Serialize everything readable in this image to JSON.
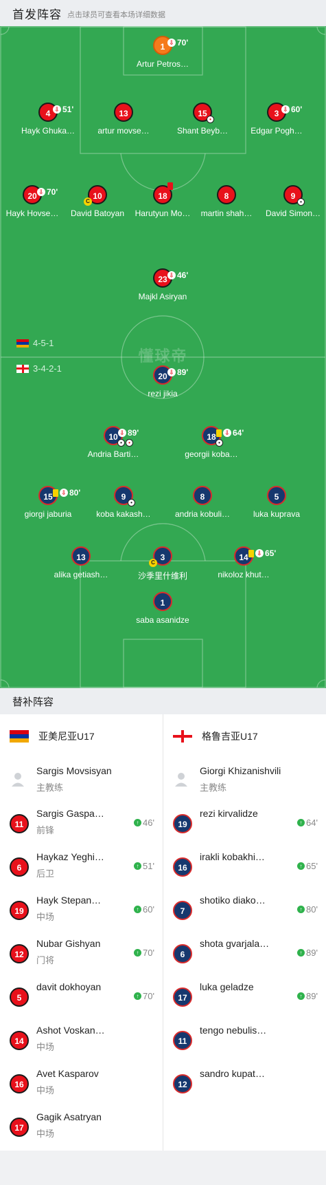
{
  "header": {
    "title": "首发阵容",
    "subtitle": "点击球员可查看本场详细数据"
  },
  "pitch": {
    "watermark": "懂球帝",
    "formations": [
      {
        "team": "armenia",
        "value": "4-5-1"
      },
      {
        "team": "georgia",
        "value": "3-4-2-1"
      }
    ],
    "home_players": [
      {
        "num": "1",
        "name": "Artur Petros…",
        "kit": "gk",
        "events": {
          "sub": true,
          "minute": "70'"
        }
      },
      {
        "num": "4",
        "name": "Hayk Ghuka…",
        "kit": "red",
        "events": {
          "sub": true,
          "minute": "51'"
        }
      },
      {
        "num": "13",
        "name": "artur movse…",
        "kit": "red"
      },
      {
        "num": "15",
        "name": "Shant Beyb…",
        "kit": "red",
        "ball": "og"
      },
      {
        "num": "3",
        "name": "Edgar Pogh…",
        "kit": "red",
        "events": {
          "sub": true,
          "minute": "60'"
        }
      },
      {
        "num": "20",
        "name": "Hayk Hovse…",
        "kit": "red",
        "events": {
          "sub": true,
          "minute": "70'"
        }
      },
      {
        "num": "10",
        "name": "David Batoyan",
        "kit": "red",
        "captain": "C"
      },
      {
        "num": "18",
        "name": "Harutyun Mo…",
        "kit": "red",
        "events": {
          "red_card": true
        }
      },
      {
        "num": "8",
        "name": "martin shah…",
        "kit": "red"
      },
      {
        "num": "9",
        "name": "David Simon…",
        "kit": "red",
        "ball": "goal"
      },
      {
        "num": "23",
        "name": "Majkl Asiryan",
        "kit": "red",
        "events": {
          "sub": true,
          "minute": "46'"
        }
      }
    ],
    "away_players": [
      {
        "num": "20",
        "name": "rezi jikia",
        "kit": "blue",
        "events": {
          "sub": true,
          "minute": "89'"
        }
      },
      {
        "num": "10",
        "name": "Andria Barti…",
        "kit": "blue",
        "events": {
          "sub": true,
          "minute": "89'"
        },
        "ball": "goal2"
      },
      {
        "num": "18",
        "name": "georgii koba…",
        "kit": "blue",
        "events": {
          "yellow": true,
          "sub": true,
          "minute": "64'"
        },
        "ball": "goal"
      },
      {
        "num": "15",
        "name": "giorgi jaburia",
        "kit": "blue",
        "events": {
          "yellow": true,
          "sub": true,
          "minute": "80'"
        }
      },
      {
        "num": "9",
        "name": "koba kakash…",
        "kit": "blue",
        "ball": "goal"
      },
      {
        "num": "8",
        "name": "andria kobuli…",
        "kit": "blue"
      },
      {
        "num": "5",
        "name": "luka kuprava",
        "kit": "blue"
      },
      {
        "num": "13",
        "name": "alika getiash…",
        "kit": "blue"
      },
      {
        "num": "3",
        "name": "沙季里什维利",
        "kit": "blue",
        "captain": "C"
      },
      {
        "num": "14",
        "name": "nikoloz khut…",
        "kit": "blue",
        "events": {
          "yellow": true,
          "sub": true,
          "minute": "65'"
        }
      },
      {
        "num": "1",
        "name": "saba asanidze",
        "kit": "blue"
      }
    ]
  },
  "subs": {
    "title": "替补阵容",
    "home": {
      "team": "亚美尼亚U17",
      "coach": {
        "name": "Sargis Movsisyan",
        "role": "主教练"
      },
      "players": [
        {
          "num": "11",
          "name": "Sargis Gaspa…",
          "pos": "前锋",
          "in": "46'"
        },
        {
          "num": "6",
          "name": "Haykaz Yeghi…",
          "pos": "后卫",
          "in": "51'"
        },
        {
          "num": "19",
          "name": "Hayk Stepan…",
          "pos": "中场",
          "in": "60'"
        },
        {
          "num": "12",
          "name": "Nubar Gishyan",
          "pos": "门将",
          "in": "70'"
        },
        {
          "num": "5",
          "name": "davit dokhoyan",
          "pos": "",
          "in": "70'"
        },
        {
          "num": "14",
          "name": "Ashot Voskan…",
          "pos": "中场",
          "in": ""
        },
        {
          "num": "16",
          "name": "Avet Kasparov",
          "pos": "中场",
          "in": ""
        },
        {
          "num": "17",
          "name": "Gagik Asatryan",
          "pos": "中场",
          "in": ""
        }
      ]
    },
    "away": {
      "team": "格鲁吉亚U17",
      "coach": {
        "name": "Giorgi Khizanishvili",
        "role": "主教练"
      },
      "players": [
        {
          "num": "19",
          "name": "rezi kirvalidze",
          "pos": "",
          "in": "64'"
        },
        {
          "num": "16",
          "name": "irakli kobakhi…",
          "pos": "",
          "in": "65'"
        },
        {
          "num": "7",
          "name": "shotiko diako…",
          "pos": "",
          "in": "80'"
        },
        {
          "num": "6",
          "name": "shota gvarjala…",
          "pos": "",
          "in": "89'"
        },
        {
          "num": "17",
          "name": "luka geladze",
          "pos": "",
          "in": "89'"
        },
        {
          "num": "11",
          "name": "tengo nebulis…",
          "pos": "",
          "in": ""
        },
        {
          "num": "12",
          "name": "sandro kupat…",
          "pos": "",
          "in": ""
        }
      ]
    }
  },
  "colors": {
    "pitch": "#33a852",
    "home_kit": "#e8111b",
    "away_kit": "#16386e",
    "gk_kit": "#f57a1c",
    "sub_in": "#2fb24c"
  }
}
